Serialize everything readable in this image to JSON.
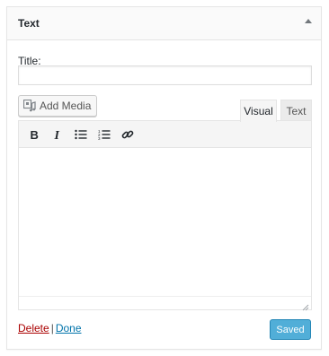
{
  "widget": {
    "title": "Text",
    "toggle_icon": "arrow-up-icon"
  },
  "form": {
    "title_label": "Title:",
    "title_value": "",
    "title_placeholder": ""
  },
  "media": {
    "add_media_label": "Add Media",
    "icon": "media-icon"
  },
  "tabs": {
    "visual": "Visual",
    "text": "Text",
    "active": "Visual"
  },
  "toolbar": {
    "buttons": [
      "bold-icon",
      "italic-icon",
      "bulleted-list-icon",
      "numbered-list-icon",
      "link-icon"
    ]
  },
  "actions": {
    "delete_label": "Delete",
    "separator": "|",
    "done_label": "Done",
    "saved_label": "Saved"
  },
  "colors": {
    "accent": "#0073aa",
    "saved_button_bg": "#33a1d2",
    "delete_link": "#aa0000"
  }
}
